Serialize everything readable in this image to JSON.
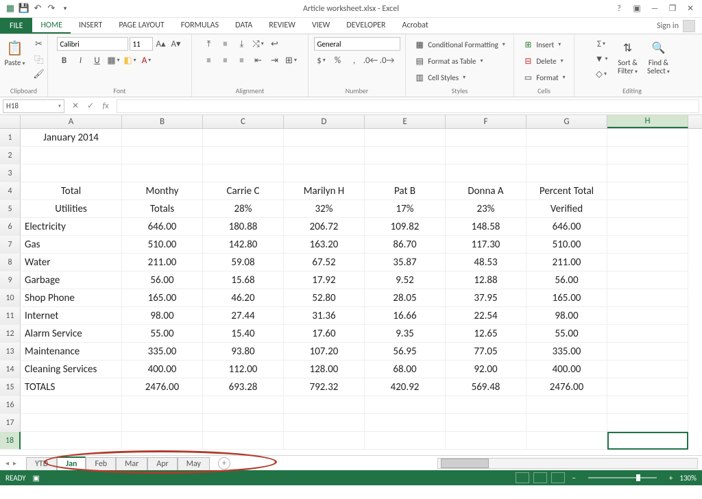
{
  "titlebar": {
    "title": "Article worksheet.xlsx - Excel"
  },
  "ribbon_tabs": {
    "file": "FILE",
    "tabs": [
      "HOME",
      "INSERT",
      "PAGE LAYOUT",
      "FORMULAS",
      "DATA",
      "REVIEW",
      "VIEW",
      "DEVELOPER",
      "Acrobat"
    ],
    "active": 0,
    "signin": "Sign in"
  },
  "ribbon": {
    "clipboard": {
      "paste": "Paste",
      "label": "Clipboard"
    },
    "font": {
      "name": "Calibri",
      "size": "11",
      "label": "Font"
    },
    "alignment": {
      "label": "Alignment"
    },
    "number": {
      "format": "General",
      "label": "Number"
    },
    "styles": {
      "cond": "Conditional Formatting",
      "table": "Format as Table",
      "cell": "Cell Styles",
      "label": "Styles"
    },
    "cells": {
      "insert": "Insert",
      "delete": "Delete",
      "format": "Format",
      "label": "Cells"
    },
    "editing": {
      "sort": "Sort &\nFilter",
      "find": "Find &\nSelect",
      "label": "Editing"
    }
  },
  "namebox": "H18",
  "columns": [
    "A",
    "B",
    "C",
    "D",
    "E",
    "F",
    "G",
    "H"
  ],
  "active_col": "H",
  "active_row": 18,
  "row_headers": [
    1,
    2,
    3,
    4,
    5,
    6,
    7,
    8,
    9,
    10,
    11,
    12,
    13,
    14,
    15,
    16,
    17,
    18
  ],
  "cells": {
    "r1": [
      "January 2014",
      "",
      "",
      "",
      "",
      "",
      "",
      ""
    ],
    "r2": [
      "",
      "",
      "",
      "",
      "",
      "",
      "",
      ""
    ],
    "r3": [
      "",
      "",
      "",
      "",
      "",
      "",
      "",
      ""
    ],
    "r4": [
      "Total",
      "Monthy",
      "Carrie C",
      "Marilyn H",
      "Pat B",
      "Donna A",
      "Percent Total",
      ""
    ],
    "r5": [
      "Utilities",
      "Totals",
      "28%",
      "32%",
      "17%",
      "23%",
      "Verified",
      ""
    ],
    "r6": [
      "Electricity",
      "646.00",
      "180.88",
      "206.72",
      "109.82",
      "148.58",
      "646.00",
      ""
    ],
    "r7": [
      "Gas",
      "510.00",
      "142.80",
      "163.20",
      "86.70",
      "117.30",
      "510.00",
      ""
    ],
    "r8": [
      "Water",
      "211.00",
      "59.08",
      "67.52",
      "35.87",
      "48.53",
      "211.00",
      ""
    ],
    "r9": [
      "Garbage",
      "56.00",
      "15.68",
      "17.92",
      "9.52",
      "12.88",
      "56.00",
      ""
    ],
    "r10": [
      "Shop Phone",
      "165.00",
      "46.20",
      "52.80",
      "28.05",
      "37.95",
      "165.00",
      ""
    ],
    "r11": [
      "Internet",
      "98.00",
      "27.44",
      "31.36",
      "16.66",
      "22.54",
      "98.00",
      ""
    ],
    "r12": [
      "Alarm Service",
      "55.00",
      "15.40",
      "17.60",
      "9.35",
      "12.65",
      "55.00",
      ""
    ],
    "r13": [
      "Maintenance",
      "335.00",
      "93.80",
      "107.20",
      "56.95",
      "77.05",
      "335.00",
      ""
    ],
    "r14": [
      "Cleaning Services",
      "400.00",
      "112.00",
      "128.00",
      "68.00",
      "92.00",
      "400.00",
      ""
    ],
    "r15": [
      "TOTALS",
      "2476.00",
      "693.28",
      "792.32",
      "420.92",
      "569.48",
      "2476.00",
      ""
    ],
    "r16": [
      "",
      "",
      "",
      "",
      "",
      "",
      "",
      ""
    ],
    "r17": [
      "",
      "",
      "",
      "",
      "",
      "",
      "",
      ""
    ],
    "r18": [
      "",
      "",
      "",
      "",
      "",
      "",
      "",
      ""
    ]
  },
  "sheets": [
    "YTD",
    "Jan",
    "Feb",
    "Mar",
    "Apr",
    "May"
  ],
  "active_sheet": 1,
  "status": {
    "ready": "READY",
    "zoom": "130%"
  }
}
